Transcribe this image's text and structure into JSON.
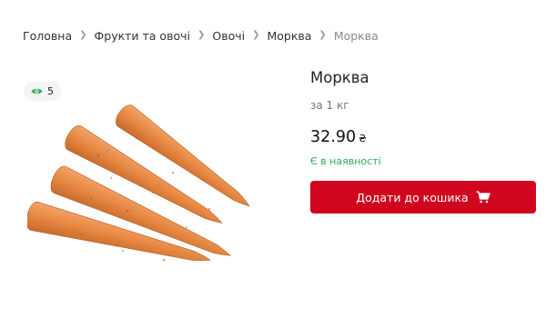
{
  "breadcrumb": {
    "items": [
      {
        "label": "Головна"
      },
      {
        "label": "Фрукти та овочі"
      },
      {
        "label": "Овочі"
      },
      {
        "label": "Морква"
      },
      {
        "label": "Морква"
      }
    ],
    "separator_icon": "chevron-right-icon"
  },
  "views": {
    "count": "5",
    "icon": "eye-icon",
    "color": "#2aa852"
  },
  "product": {
    "title": "Морква",
    "unit": "за 1 кг",
    "price": "32.90",
    "currency": "₴",
    "stock_status": "Є в наявності",
    "image_icon": "carrots-image"
  },
  "cart": {
    "button_label": "Додати до кошика",
    "icon": "shopping-cart-icon",
    "color": "#d0061f"
  },
  "colors": {
    "accent": "#d0061f",
    "in_stock": "#2aa852",
    "carrot": "#e88a45"
  }
}
